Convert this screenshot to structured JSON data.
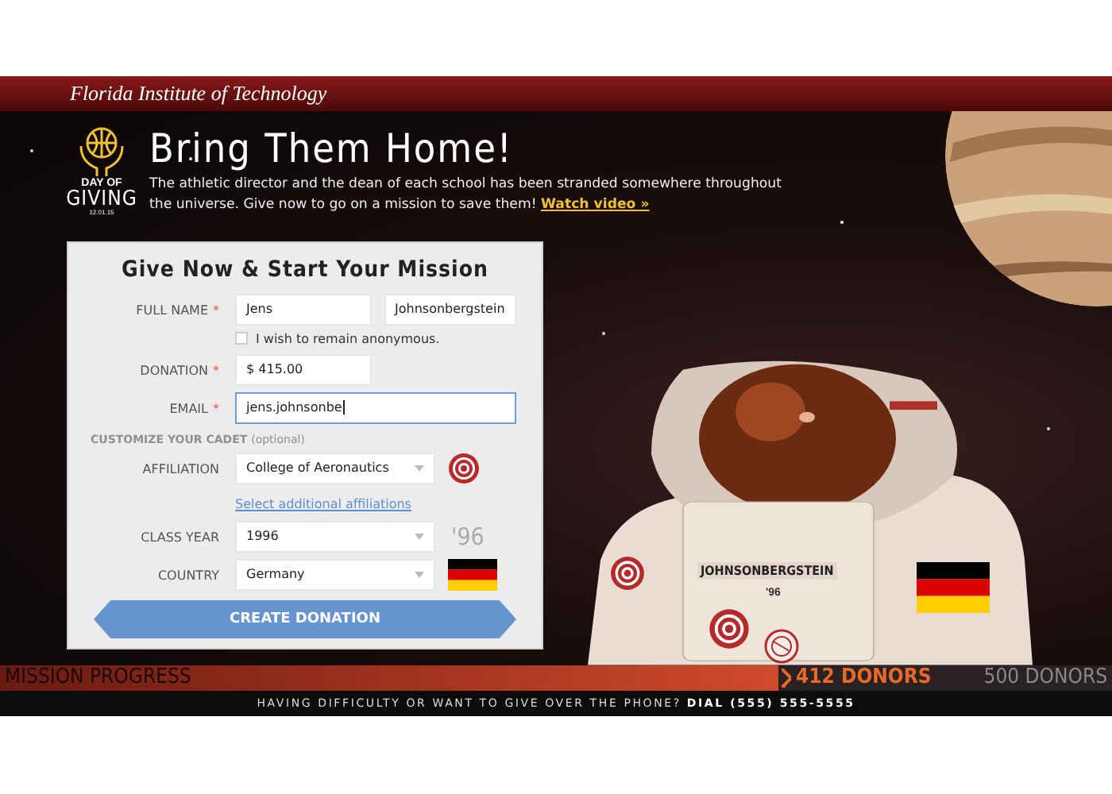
{
  "header": {
    "institution": "Florida Institute of Technology"
  },
  "logo": {
    "line1": "DAY OF",
    "line2": "GIVING",
    "date": "12.01.15"
  },
  "intro": {
    "title": "Bring Them Home!",
    "text": "The athletic director and the dean of each school has been stranded somewhere throughout the universe. Give now to go on a mission to save them!",
    "link": "Watch video »"
  },
  "form": {
    "title": "Give Now & Start Your Mission",
    "full_name": {
      "label": "FULL NAME",
      "mark": "*",
      "first": "Jens",
      "last": "Johnsonbergstein"
    },
    "anonymous": {
      "label": "I wish to remain anonymous.",
      "checked": false
    },
    "donation": {
      "label": "DONATION",
      "mark": "*",
      "value": "$ 415.00"
    },
    "email": {
      "label": "EMAIL",
      "mark": "*",
      "value": "jens.johnsonbe",
      "focused": true
    },
    "customize": {
      "label": "CUSTOMIZE YOUR CADET",
      "note": "(optional)"
    },
    "affiliation": {
      "label": "AFFILIATION",
      "value": "College of Aeronautics",
      "link": "Select additional affiliations"
    },
    "class_year": {
      "label": "CLASS YEAR",
      "value": "1996",
      "preview": "'96"
    },
    "country": {
      "label": "COUNTRY",
      "value": "Germany"
    },
    "submit": "CREATE DONATION"
  },
  "cadet": {
    "name": "JOHNSONBERGSTEIN",
    "year": "'96"
  },
  "progress": {
    "label": "MISSION PROGRESS",
    "level": 0.7,
    "current": "412 DONORS",
    "goal": "500 DONORS"
  },
  "footer": {
    "text": "HAVING DIFFICULTY OR WANT TO GIVE OVER THE PHONE? **DIAL (555) 555-5555**"
  }
}
